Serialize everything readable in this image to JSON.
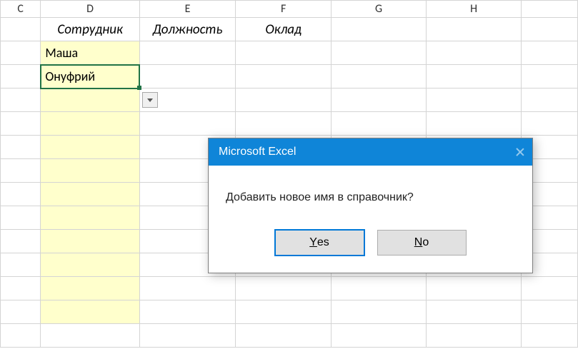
{
  "columns": {
    "C": "C",
    "D": "D",
    "E": "E",
    "F": "F",
    "G": "G",
    "H": "H"
  },
  "headers": {
    "D": "Сотрудник",
    "E": "Должность",
    "F": "Оклад"
  },
  "cells": {
    "D_row2": "Маша",
    "D_row3": "Онуфрий"
  },
  "dialog": {
    "title": "Microsoft Excel",
    "message": "Добавить новое имя в справочник?",
    "yes_mn": "Y",
    "yes_rest": "es",
    "no_mn": "N",
    "no_rest": "o"
  },
  "chart_data": {
    "type": "table",
    "note": "Excel worksheet fragment with a message box",
    "columns_visible": [
      "C",
      "D",
      "E",
      "F",
      "G",
      "H"
    ],
    "header_row": {
      "D": "Сотрудник",
      "E": "Должность",
      "F": "Оклад"
    },
    "data_rows": [
      {
        "D": "Маша"
      },
      {
        "D": "Онуфрий"
      }
    ],
    "highlighted_range": "D2:D13 (light yellow fill)",
    "active_cell": "D3",
    "data_validation_dropdown_on": "D3",
    "dialog": {
      "title": "Microsoft Excel",
      "message": "Добавить новое имя в справочник?",
      "buttons": [
        "Yes",
        "No"
      ],
      "default_button": "Yes"
    }
  }
}
